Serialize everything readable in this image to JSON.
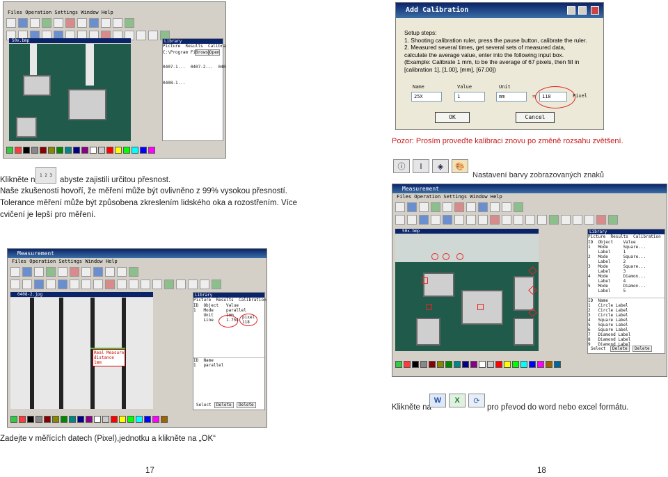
{
  "left_top": {
    "caption_prefix": "Klikněte na",
    "caption_suffix": "abyste zajistili určitou přesnost.",
    "ruler_label": "1 2 3",
    "paragraph": "Naše zkušenosti hovoří, že měření může být ovlivněno z 99% vysokou přesností. Tolerance měření může být způsobena zkreslením lidského oka a rozostřením. Více cvičení je lepší pro měření."
  },
  "screenshot_a": {
    "menu": "Files  Operation  Settings  Window  Help",
    "image_title": "50x.bmp",
    "library_title": "Library",
    "library_tabs": "Picture  Results  Calibration",
    "path": "C:\\Program Files\\",
    "browse": "Brows",
    "open": "Open",
    "thumbs": "0407-1...  0407-2...  0407-3...",
    "thumb2": "0408-1..."
  },
  "dialog": {
    "title": "Add Calibration",
    "steps": "Setup steps:\n1. Shooting calibration ruler, press the pause button, calibrate the ruler.\n2. Measured several times, get several sets of measured data,\ncalculate the average value, enter into the following input box.\n(Example: Calibrate 1 mm, to be the average of 67 pixels, then fill in\n[calibration 1], [1.00], [mm], [67.00])",
    "col_name": "Name",
    "col_value": "Value",
    "col_unit": "Unit",
    "name_value": "25X",
    "value_value": "1",
    "unit_value": "mm",
    "equals": "=",
    "pixel_value": "118",
    "pixel_label": "Pixel",
    "ok": "OK",
    "cancel": "Cancel"
  },
  "right_top": {
    "warning": "Pozor: Prosím proveďte kalibraci znovu po změně rozsahu zvětšení.",
    "color_caption": "Nastavení barvy zobrazovaných znaků"
  },
  "screenshot_b": {
    "title": "Measurement",
    "menu": "Files  Operation  Settings  Window  Help",
    "image_title": "50x.bmp",
    "library_title": "Library",
    "tabs": "Picture  Results  Calibration",
    "results": "ID  Object    Value\n1   Mode      Square...\n    Label     1\n2   Mode      Square...\n    Label     2\n3   Mode      Square...\n    Label     3\n4   Mode      Diamon...\n    Label     4\n5   Mode      Diamon...\n    Label     5",
    "list": "ID  Name\n1   Circle Label\n2   Circle Label\n3   Circle Label\n4   Square Label\n5   Square Label\n6   Square Label\n7   Diamond Label\n8   Diamond Label\n9   Diamond Label",
    "select": "Select",
    "delete": "Delete",
    "delete_all": "Delete"
  },
  "screenshot_c": {
    "title": "Measurement",
    "menu": "Files  Operation  Settings  Window  Help",
    "image_title": "0408-2.jpg",
    "annotation": "Real Measure\ndistance\n1mm",
    "library_title": "Library",
    "tabs": "Picture  Results  Calibration",
    "results": "ID  Object   Value\n1   Mode     parallel\n    Unit     1mm\n    Line     1.754",
    "pixel_note": "pixel\n118",
    "list": "ID  Name\n1   parallel",
    "select": "Select",
    "delete": "Delete",
    "delete_all": "Delete"
  },
  "bottom_left": {
    "instruction": "Zadejte v měřících datech (Pixel),jednotku a klikněte na „OK“",
    "page_number": "17"
  },
  "bottom_right": {
    "caption_prefix": "Klikněte na",
    "caption_suffix": "pro převod do word nebo excel formátu.",
    "page_number": "18"
  }
}
